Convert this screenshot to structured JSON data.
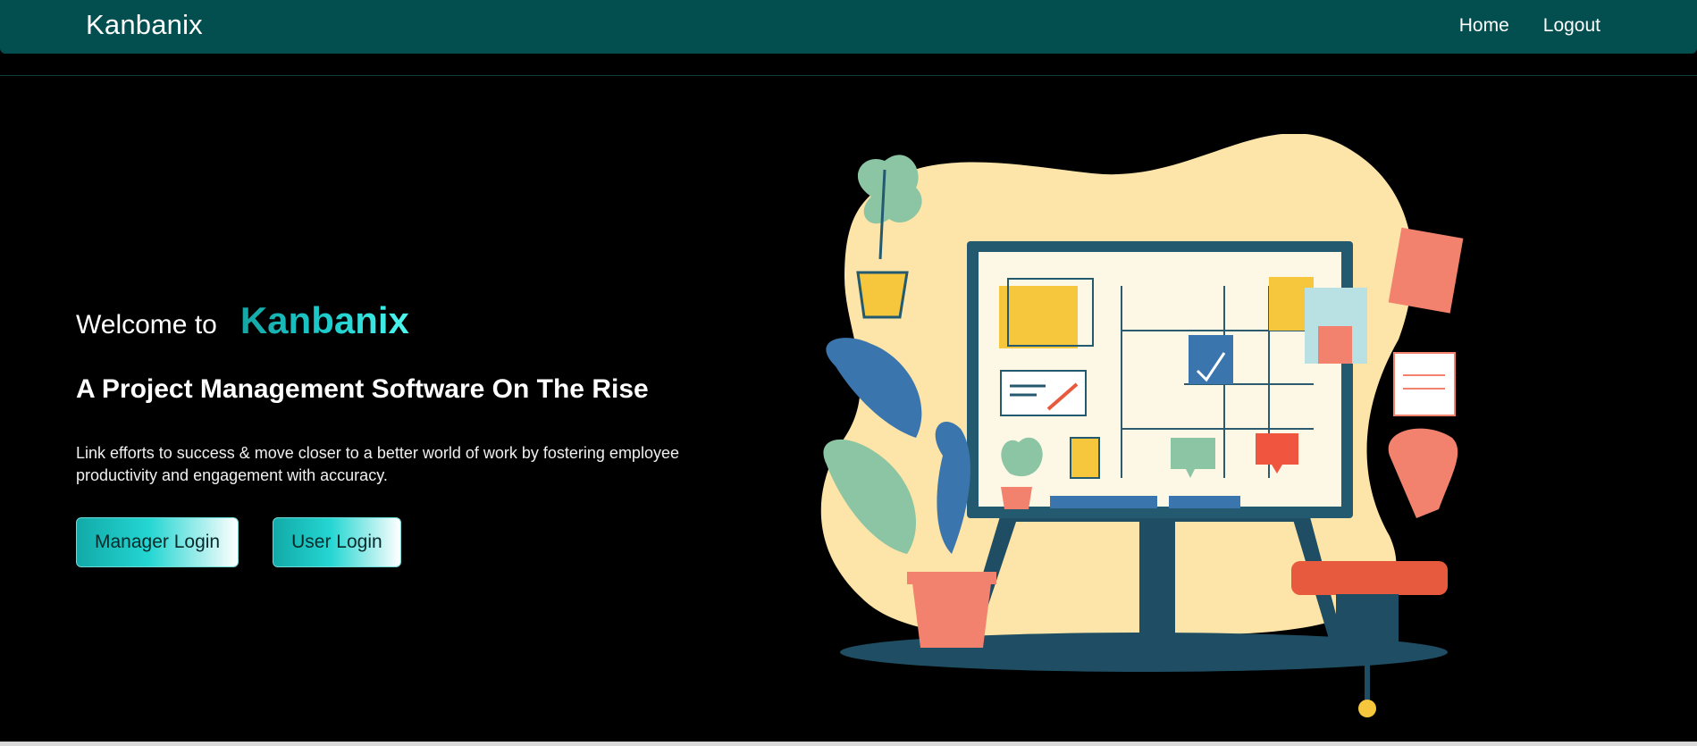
{
  "navbar": {
    "brand": "Kanbanix",
    "links": [
      {
        "label": "Home"
      },
      {
        "label": "Logout"
      }
    ]
  },
  "hero": {
    "welcome_text": "Welcome to",
    "brand_text": "Kanbanix",
    "tagline": "A Project Management Software On The Rise",
    "description": "Link efforts to success & move closer to a better world of work by fostering employee productivity and engagement with accuracy.",
    "buttons": {
      "manager_login": "Manager Login",
      "user_login": "User Login"
    }
  },
  "colors": {
    "navbar_bg": "#034e4f",
    "accent": "#1ecfcf",
    "background": "#000000"
  },
  "icons": [
    "kanban-board-illustration",
    "plant-illustration",
    "chair-illustration"
  ]
}
